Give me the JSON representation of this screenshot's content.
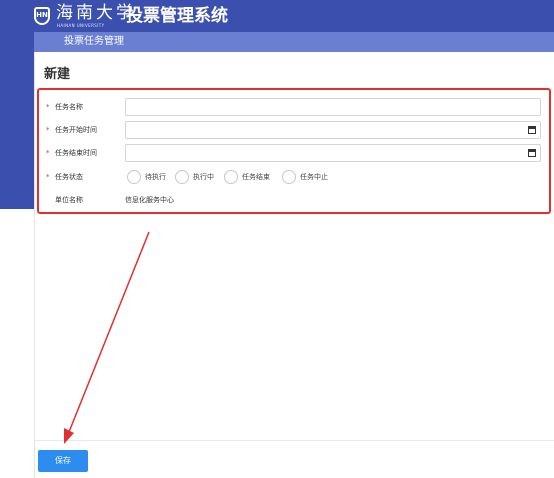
{
  "header": {
    "university_name": "海南大学",
    "university_sub": "HAINAN UNIVERSITY",
    "system_title": "投票管理系统",
    "logo_text": "HN"
  },
  "subnav": {
    "breadcrumb": "投票任务管理"
  },
  "page": {
    "title": "新建"
  },
  "form": {
    "task_name": {
      "label": "任务名称",
      "required_mark": "*",
      "value": ""
    },
    "start_time": {
      "label": "任务开始时间",
      "required_mark": "*",
      "value": "",
      "icon": "calendar-icon"
    },
    "end_time": {
      "label": "任务结束时间",
      "required_mark": "*",
      "value": "",
      "icon": "calendar-icon"
    },
    "status": {
      "label": "任务状态",
      "required_mark": "*",
      "options": [
        "待执行",
        "执行中",
        "任务结束",
        "任务中止"
      ]
    },
    "unit": {
      "label": "单位名称",
      "value": "信息化服务中心"
    }
  },
  "actions": {
    "save_label": "保存"
  },
  "colors": {
    "header_bg": "#3b4fae",
    "subnav_bg": "#6a7fd2",
    "highlight_border": "#e03030",
    "primary_button": "#2d8cf0"
  }
}
